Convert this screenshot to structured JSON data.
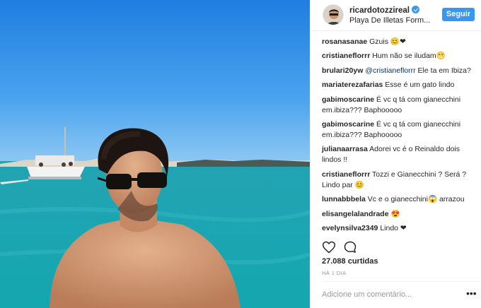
{
  "post": {
    "photo_alt": "",
    "header": {
      "username": "ricardotozzireal",
      "location": "Playa De Illetas Form...",
      "follow_label": "Seguir"
    },
    "comments": [
      {
        "user": "rosanasanae",
        "text": " Gzuis 😊❤"
      },
      {
        "user": "cristianeflorrr",
        "text": " Hum não se iludam😁"
      },
      {
        "user": "brulari20yw",
        "mention": " @cristianeflorrr",
        "text": " Ele ta em Ibiza?"
      },
      {
        "user": "mariaterezafarias",
        "text": " Esse é um gato lindo"
      },
      {
        "user": "gabimoscarine",
        "text": " É vc q tá com gianecchini em.ibiza??? Baphooooo"
      },
      {
        "user": "gabimoscarine",
        "text": " É vc q tá com gianecchini em.ibiza??? Baphooooo"
      },
      {
        "user": "julianaarrasa",
        "text": " Adorei vc é o Reinaldo dois lindos !!"
      },
      {
        "user": "cristianeflorrr",
        "text": " Tozzi e Gianecchini ? Será ? Lindo par 😊"
      },
      {
        "user": "lunnabbbela",
        "text": " Vc e o gianecchini😱 arrazou"
      },
      {
        "user": "elisangelalandrade",
        "text": " 😍"
      },
      {
        "user": "evelynsilva2349",
        "text": " Lindo ❤"
      }
    ],
    "likes_text": "27.088 curtidas",
    "time_ago": "HÁ 1 DIA",
    "comment_placeholder": "Adicione um comentário...",
    "more_label": "•••",
    "icons": {
      "like": "heart-icon",
      "comment": "comment-icon",
      "verified": "verified-badge-icon"
    },
    "colors": {
      "accent": "#3897f0",
      "text": "#262626",
      "muted": "#999999"
    }
  }
}
